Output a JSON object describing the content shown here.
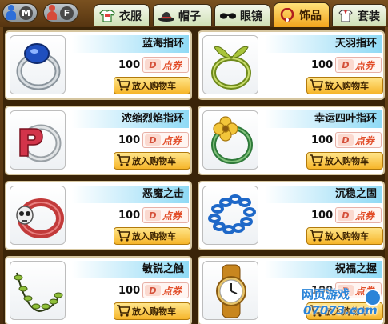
{
  "gender": {
    "male": {
      "label": "M",
      "icon": "male-icon",
      "color": "#2f6fd8"
    },
    "female": {
      "label": "F",
      "icon": "female-icon",
      "color": "#d64a3a"
    }
  },
  "tabs": [
    {
      "label": "衣服",
      "icon": "shirt-icon",
      "active": false
    },
    {
      "label": "帽子",
      "icon": "hat-icon",
      "active": false
    },
    {
      "label": "眼镜",
      "icon": "glasses-icon",
      "active": false
    },
    {
      "label": "饰品",
      "icon": "necklace-icon",
      "active": true
    },
    {
      "label": "套装",
      "icon": "suit-icon",
      "active": false
    }
  ],
  "items": [
    {
      "name": "蓝海指环",
      "price": "100",
      "currency_icon": "coupon-icon",
      "currency": "点券",
      "button": "放入购物车",
      "image": "blue-ring-icon"
    },
    {
      "name": "天羽指环",
      "price": "100",
      "currency_icon": "coupon-icon",
      "currency": "点券",
      "button": "放入购物车",
      "image": "leaf-ring-icon"
    },
    {
      "name": "浓缩烈焰指环",
      "price": "100",
      "currency_icon": "coupon-icon",
      "currency": "点券",
      "button": "放入购物车",
      "image": "red-p-ring-icon"
    },
    {
      "name": "幸运四叶指环",
      "price": "100",
      "currency_icon": "coupon-icon",
      "currency": "点券",
      "button": "放入购物车",
      "image": "clover-ring-icon"
    },
    {
      "name": "恶魔之击",
      "price": "100",
      "currency_icon": "coupon-icon",
      "currency": "点券",
      "button": "放入购物车",
      "image": "skull-bracelet-icon"
    },
    {
      "name": "沉稳之固",
      "price": "100",
      "currency_icon": "coupon-icon",
      "currency": "点券",
      "button": "放入购物车",
      "image": "chain-bracelet-icon"
    },
    {
      "name": "敏锐之触",
      "price": "100",
      "currency_icon": "coupon-icon",
      "currency": "点券",
      "button": "放入购物车",
      "image": "leaf-necklace-icon"
    },
    {
      "name": "祝福之握",
      "price": "100",
      "currency_icon": "coupon-icon",
      "currency": "点券",
      "button": "放入购物车",
      "image": "watch-icon"
    }
  ],
  "watermark": {
    "line1": "网页游戏",
    "line2": "07073.com"
  }
}
